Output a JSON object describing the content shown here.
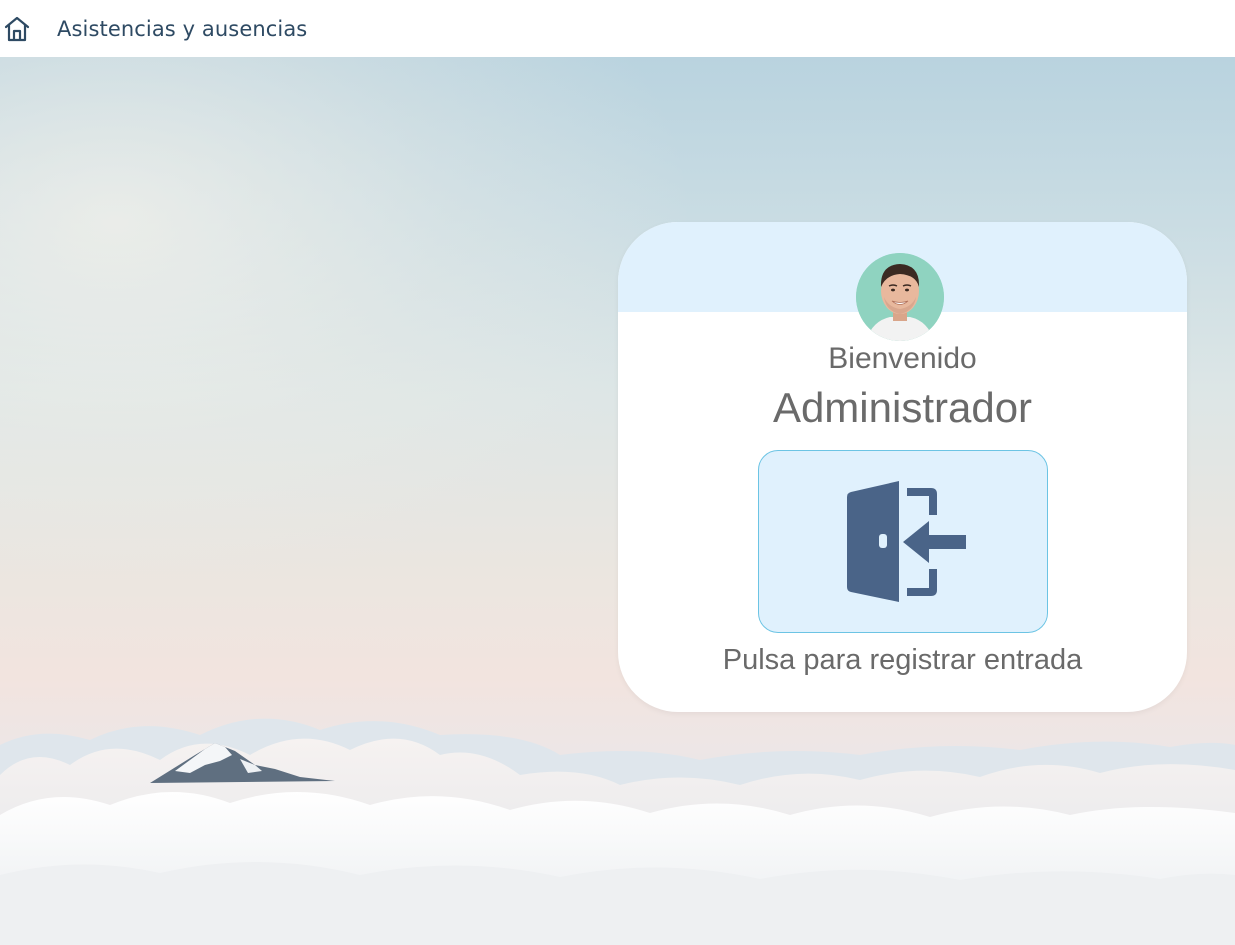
{
  "header": {
    "home_icon": "home-icon",
    "title": "Asistencias y ausencias"
  },
  "card": {
    "avatar_icon": "user-avatar",
    "welcome": "Bienvenido",
    "username": "Administrador",
    "checkin_icon": "door-enter-icon",
    "checkin_label": "Pulsa para registrar entrada"
  },
  "colors": {
    "header_text": "#2e4a63",
    "card_header_bg": "#e0f1fd",
    "button_border": "#6cc4e4",
    "icon_color": "#4a6488",
    "text_gray": "#6a6a6a"
  }
}
